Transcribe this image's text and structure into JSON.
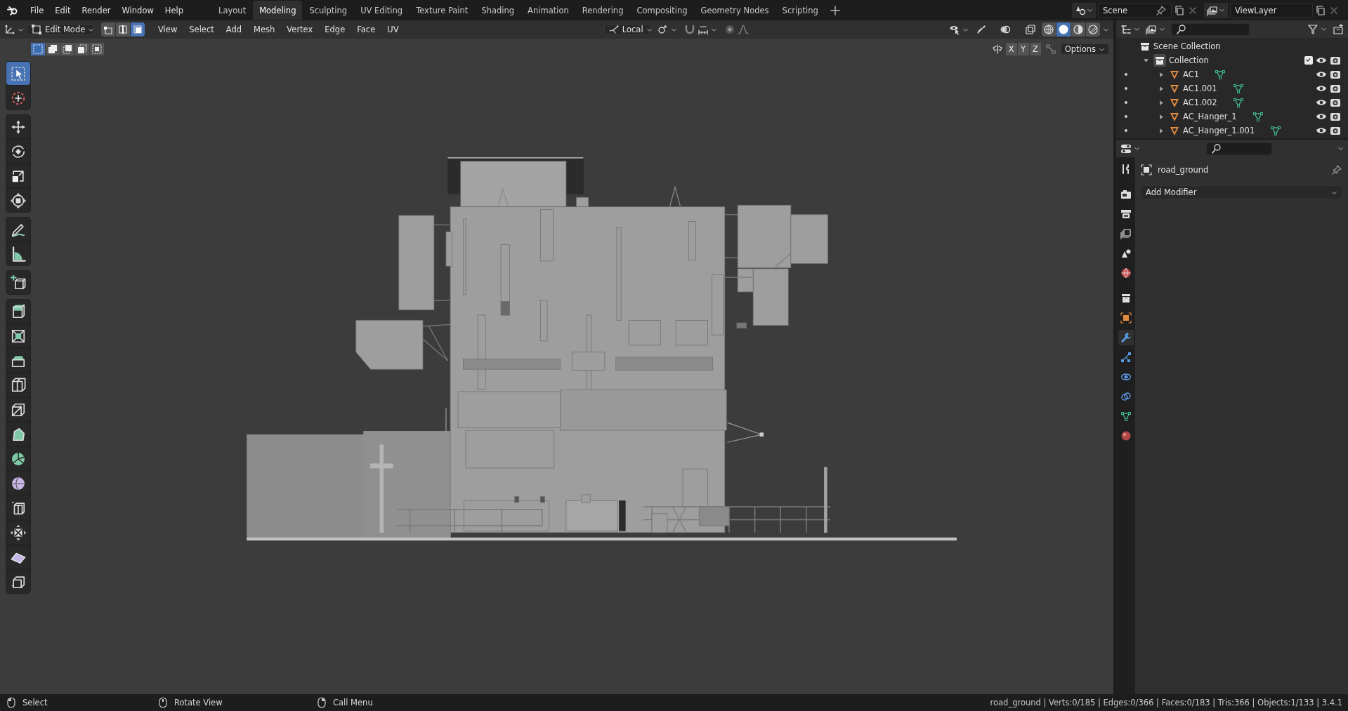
{
  "menu": [
    "File",
    "Edit",
    "Render",
    "Window",
    "Help"
  ],
  "workspaces": [
    {
      "label": "Layout",
      "selected": false
    },
    {
      "label": "Modeling",
      "selected": true
    },
    {
      "label": "Sculpting",
      "selected": false
    },
    {
      "label": "UV Editing",
      "selected": false
    },
    {
      "label": "Texture Paint",
      "selected": false
    },
    {
      "label": "Shading",
      "selected": false
    },
    {
      "label": "Animation",
      "selected": false
    },
    {
      "label": "Rendering",
      "selected": false
    },
    {
      "label": "Compositing",
      "selected": false
    },
    {
      "label": "Geometry Nodes",
      "selected": false
    },
    {
      "label": "Scripting",
      "selected": false
    }
  ],
  "scene": "Scene",
  "view_layer": "ViewLayer",
  "header": {
    "mode": "Edit Mode",
    "select_modes": [
      {
        "kind": "vertex",
        "selected": false
      },
      {
        "kind": "edge",
        "selected": false
      },
      {
        "kind": "face",
        "selected": true
      }
    ],
    "menus": [
      "View",
      "Select",
      "Add",
      "Mesh",
      "Vertex",
      "Edge",
      "Face",
      "UV"
    ],
    "orientation": "Local",
    "shading": [
      {
        "kind": "wireframe",
        "selected": false
      },
      {
        "kind": "solid",
        "selected": true
      },
      {
        "kind": "material",
        "selected": false
      },
      {
        "kind": "rendered",
        "selected": false
      }
    ],
    "box_modes": [
      {
        "kind": "set",
        "selected": true
      },
      {
        "kind": "extend",
        "selected": false
      },
      {
        "kind": "subtract",
        "selected": false
      },
      {
        "kind": "invert",
        "selected": false
      },
      {
        "kind": "intersect",
        "selected": false
      }
    ],
    "axes": [
      "X",
      "Y",
      "Z"
    ],
    "options": "Options"
  },
  "toolbar": [
    [
      {
        "kind": "select_box",
        "selected": true
      },
      {
        "kind": "cursor",
        "selected": false
      }
    ],
    [
      {
        "kind": "move",
        "selected": false
      },
      {
        "kind": "rotate",
        "selected": false
      },
      {
        "kind": "scale",
        "selected": false
      },
      {
        "kind": "transform",
        "selected": false
      }
    ],
    [
      {
        "kind": "annotate",
        "selected": false
      },
      {
        "kind": "measure",
        "selected": false
      }
    ],
    [
      {
        "kind": "add_cube",
        "selected": false
      }
    ],
    [
      {
        "kind": "extrude",
        "selected": false
      },
      {
        "kind": "inset",
        "selected": false
      },
      {
        "kind": "bevel",
        "selected": false
      },
      {
        "kind": "loop_cut",
        "selected": false
      },
      {
        "kind": "knife",
        "selected": false
      },
      {
        "kind": "poly_build",
        "selected": false
      },
      {
        "kind": "spin",
        "selected": false
      },
      {
        "kind": "smooth",
        "selected": false
      },
      {
        "kind": "edge_slide",
        "selected": false
      },
      {
        "kind": "shrink",
        "selected": false
      },
      {
        "kind": "shear",
        "selected": false
      },
      {
        "kind": "rip",
        "selected": false
      }
    ]
  ],
  "outliner": {
    "root": "Scene Collection",
    "collection": {
      "name": "Collection",
      "expanded": true,
      "checked": true,
      "children": [
        {
          "name": "AC1",
          "expanded": false
        },
        {
          "name": "AC1.001",
          "expanded": false
        },
        {
          "name": "AC1.002",
          "expanded": false
        },
        {
          "name": "AC_Hanger_1",
          "expanded": false
        },
        {
          "name": "AC_Hanger_1.001",
          "expanded": false
        }
      ]
    }
  },
  "properties": {
    "object": "road_ground",
    "add_modifier": "Add Modifier",
    "tabs": [
      {
        "kind": "tool",
        "selected": false
      },
      {
        "kind": "render",
        "selected": false
      },
      {
        "kind": "output",
        "selected": false
      },
      {
        "kind": "view_layer",
        "selected": false
      },
      {
        "kind": "scene",
        "selected": false
      },
      {
        "kind": "world",
        "selected": false
      },
      {
        "kind": "collection",
        "selected": false
      },
      {
        "kind": "object",
        "selected": false
      },
      {
        "kind": "modifier",
        "selected": true
      },
      {
        "kind": "particles",
        "selected": false
      },
      {
        "kind": "physics",
        "selected": false
      },
      {
        "kind": "constraints",
        "selected": false
      },
      {
        "kind": "data",
        "selected": false
      },
      {
        "kind": "material",
        "selected": false
      }
    ]
  },
  "status_bar": {
    "hints": [
      {
        "kind": "left",
        "label": "Select"
      },
      {
        "kind": "middle",
        "label": "Rotate View"
      },
      {
        "kind": "right",
        "label": "Call Menu"
      }
    ],
    "stats": "road_ground | Verts:0/185 | Edges:0/366 | Faces:0/183 | Tris:366 | Objects:1/133 | 3.4.1"
  }
}
